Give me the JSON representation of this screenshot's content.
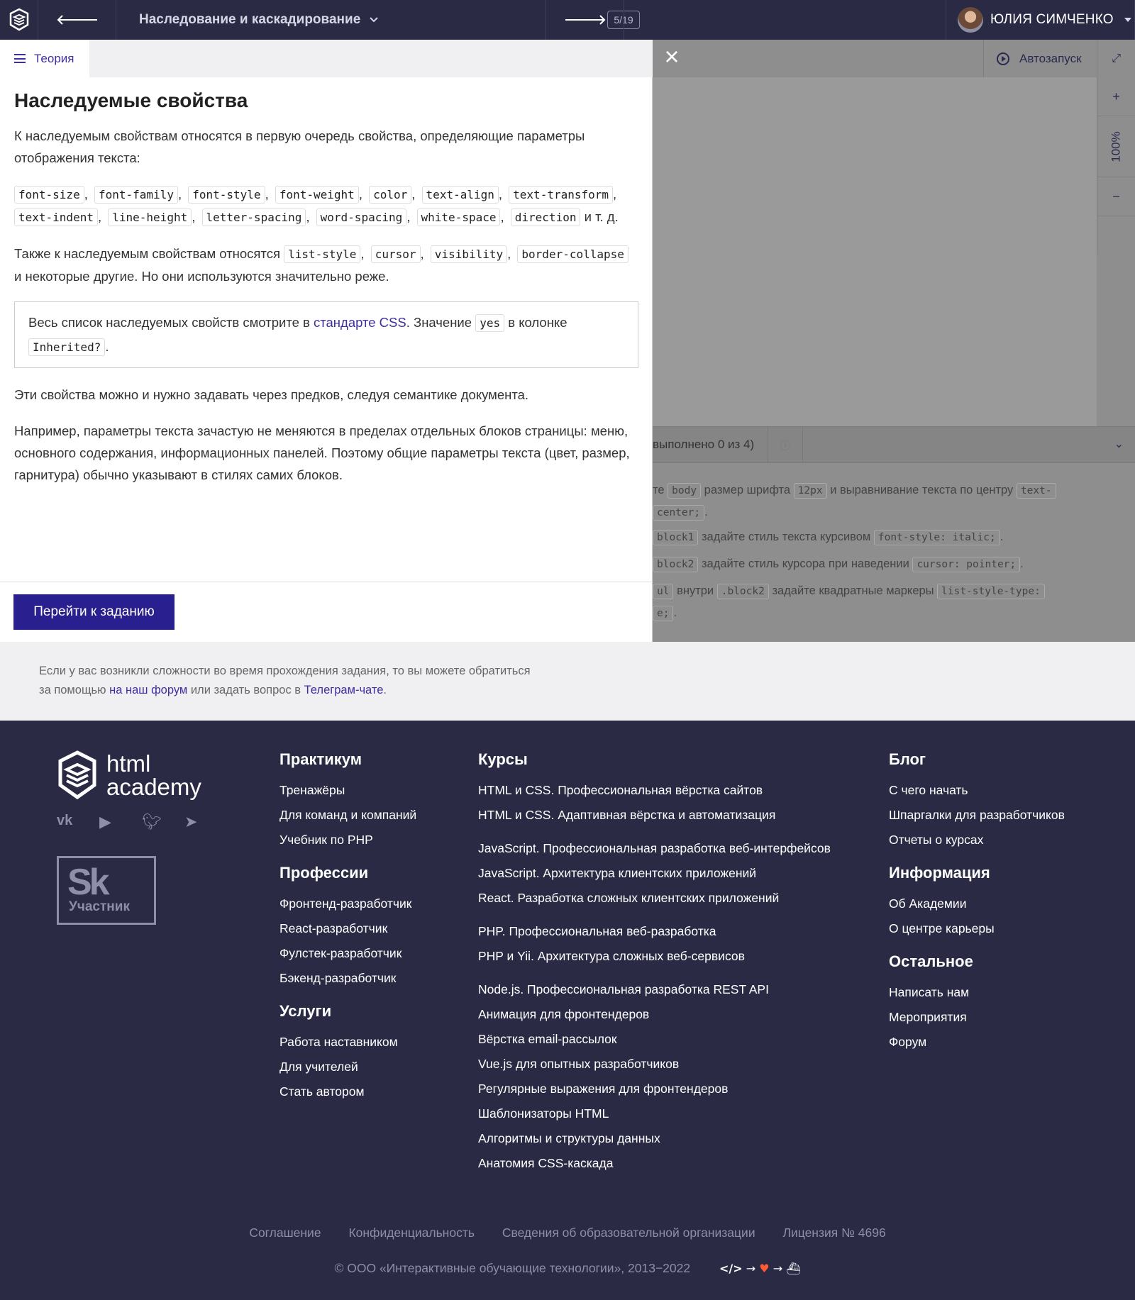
{
  "topbar": {
    "lesson_title": "Наследование и каскадирование",
    "counter": "5/19",
    "user_name": "ЮЛИЯ СИМЧЕНКО"
  },
  "theory": {
    "tab_label": "Теория",
    "heading": "Наследуемые свойства",
    "intro": "К наследуемым свойствам относятся в первую очередь свойства, определяющие параметры отображения текста:",
    "text_props": [
      "font-size",
      "font-family",
      "font-style",
      "font-weight",
      "color",
      "text-align",
      "text-transform",
      "text-indent",
      "line-height",
      "letter-spacing",
      "word-spacing",
      "white-space",
      "direction"
    ],
    "etc": "и т. д.",
    "also_prefix": "Также к наследуемым свойствам относятся",
    "also_props": [
      "list-style",
      "cursor",
      "visibility",
      "border-collapse"
    ],
    "also_suffix": "и некоторые другие. Но они используются значительно реже.",
    "note_prefix": "Весь список наследуемых свойств смотрите в",
    "note_link": "стандарте CSS",
    "note_mid": ". Значение",
    "note_yes": "yes",
    "note_after": "в колонке",
    "note_col": "Inherited?",
    "para1": "Эти свойства можно и нужно задавать через предков, следуя семантике документа.",
    "para2": "Например, параметры текста зачастую не меняются в пределах отдельных блоков страницы: меню, основного содержания, информационных панелей. Поэтому общие параметры текста (цвет, размер, гарнитура) обычно указывают в стилях самих блоков.",
    "button": "Перейти к заданию"
  },
  "editor": {
    "autorun": "Автозапуск",
    "zoom": "100%",
    "zoom_in": "+",
    "zoom_out": "−",
    "close": "×",
    "progress": "выполнено 0 из 4)",
    "tasks": [
      {
        "pre": "те",
        "c1": "body",
        "mid": "размер шрифта",
        "c2": "12px",
        "post": "и выравнивание текста по центру",
        "c3": "text-",
        "line2": "center;"
      },
      {
        "c0": "block1",
        "mid": "задайте стиль текста курсивом",
        "c1": "font-style: italic;"
      },
      {
        "c0": "block2",
        "mid": "задайте стиль курсора при наведении",
        "c1": "cursor: pointer;"
      },
      {
        "c0": "ul",
        "pre": "внутри",
        "c1": ".block2",
        "mid": "задайте квадратные маркеры",
        "c2": "list-style-type:",
        "line2": "e;"
      }
    ]
  },
  "help": {
    "line1": "Если у вас возникли сложности во время прохождения задания, то вы можете обратиться",
    "line2_pre": "за помощью",
    "forum_link": "на наш форум",
    "line2_mid": "или задать вопрос в",
    "telegram_link": "Телеграм-чате"
  },
  "footer": {
    "brand_line1": "html",
    "brand_line2": "academy",
    "sk_logo": "Sk",
    "sk_label": "Участник",
    "socials": [
      "vk-icon",
      "youtube-icon",
      "twitter-icon",
      "telegram-icon"
    ],
    "practicum": {
      "title": "Практикум",
      "items": [
        "Тренажёры",
        "Для команд и компаний",
        "Учебник по PHP"
      ]
    },
    "professions": {
      "title": "Профессии",
      "items": [
        "Фронтенд-разработчик",
        "React-разработчик",
        "Фулстек-разработчик",
        "Бэкенд-разработчик"
      ]
    },
    "services": {
      "title": "Услуги",
      "items": [
        "Работа наставником",
        "Для учителей",
        "Стать автором"
      ]
    },
    "courses": {
      "title": "Курсы",
      "groups": [
        [
          "HTML и CSS. Профессиональная вёрстка сайтов",
          "HTML и CSS. Адаптивная вёрстка и автоматизация"
        ],
        [
          "JavaScript. Профессиональная разработка веб-интерфейсов",
          "JavaScript. Архитектура клиентских приложений",
          "React. Разработка сложных клиентских приложений"
        ],
        [
          "PHP. Профессиональная веб-разработка",
          "PHP и Yii. Архитектура сложных веб-сервисов"
        ],
        [
          "Node.js. Профессиональная разработка REST API",
          "Анимация для фронтендеров",
          "Вёрстка email-рассылок",
          "Vue.js для опытных разработчиков",
          "Регулярные выражения для фронтендеров",
          "Шаблонизаторы HTML",
          "Алгоритмы и структуры данных",
          "Анатомия CSS-каскада"
        ]
      ]
    },
    "blog": {
      "title": "Блог",
      "items": [
        "С чего начать",
        "Шпаргалки для разработчиков",
        "Отчеты о курсах"
      ]
    },
    "info": {
      "title": "Информация",
      "items": [
        "Об Академии",
        "О центре карьеры"
      ]
    },
    "other": {
      "title": "Остальное",
      "items": [
        "Написать нам",
        "Мероприятия",
        "Форум"
      ]
    },
    "bottom_links": [
      "Соглашение",
      "Конфиденциальность",
      "Сведения об образовательной организации",
      "Лицензия № 4696"
    ],
    "copyright": "© ООО «Интерактивные обучающие технологии», 2013−2022",
    "chain": {
      "code": "</>",
      "arrow": "→",
      "heart": "♥",
      "ship": "⛴"
    }
  }
}
